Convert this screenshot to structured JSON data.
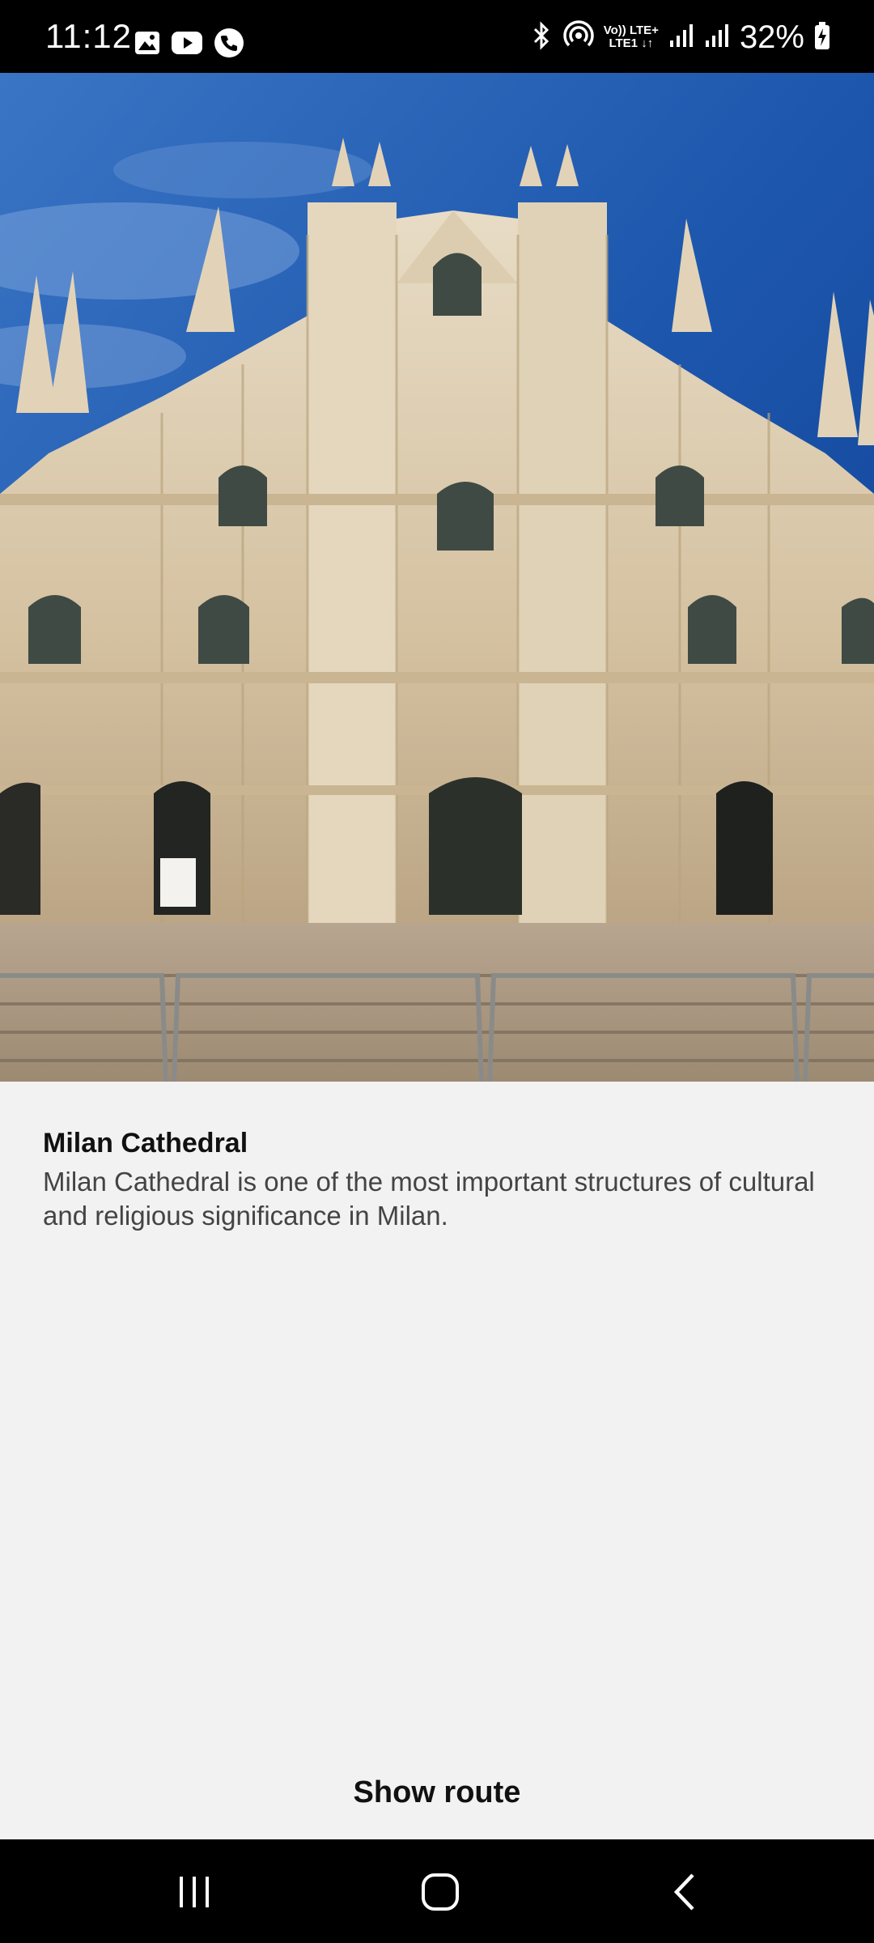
{
  "status_bar": {
    "time": "11:12",
    "network_label_top": "Vo)) LTE+",
    "network_label_bottom": "LTE1 ↓↑",
    "battery": "32%",
    "left_icons": [
      "gallery-icon",
      "youtube-icon",
      "phone-call-icon"
    ],
    "right_icons": [
      "bluetooth-icon",
      "hotspot-icon",
      "signal-icon",
      "signal-icon",
      "battery-charging-icon"
    ]
  },
  "hero": {
    "image_subject": "Milan Cathedral facade"
  },
  "place": {
    "title": "Milan Cathedral",
    "description": "Milan Cathedral is one of the most important structures of cultural and religious significance in Milan."
  },
  "actions": {
    "show_route_label": "Show route"
  },
  "nav_bar": {
    "buttons": [
      "recent-apps-icon",
      "home-icon",
      "back-icon"
    ]
  },
  "colors": {
    "background": "#f2f2f2",
    "bar": "#000000",
    "sky": "#1a4fa0",
    "stone": "#d8c6a8"
  }
}
